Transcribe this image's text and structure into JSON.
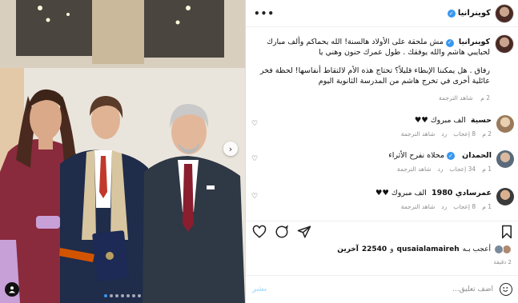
{
  "post": {
    "username": "كوينرانيا",
    "more_icon": "ellipsis-icon"
  },
  "caption": {
    "username": "كوينرانيا",
    "line1": "مش ملحقة على الأولاد هالسنة! الله يحماكم وألف مبارك لحبايبي هاشم والله يوفقك . طول عمرك حنون وهني يا",
    "line2": "رفاق . هل يمكننا الإبطاء قليلاً؟ تحتاج هذه الأم لالتقاط أنفاسها! لحظة فخر عائلية أخرى في تخرج هاشم من المدرسة الثانوية اليوم",
    "see_translation": "شاهد الترجمة",
    "age": "2 م"
  },
  "comments": [
    {
      "username": "حسية",
      "text": "الف مبروك ♥♥",
      "age": "2 م",
      "likes": "8 إعجاب",
      "reply": "رد",
      "see_translation": "شاهد الترجمة"
    },
    {
      "username": "الحمدان",
      "extra": "محلاه نفرح الأثراء",
      "age": "1 م",
      "likes": "34 إعجاب",
      "reply": "رد",
      "see_translation": "شاهد الترجمة"
    },
    {
      "username": "عمرسادي 1980",
      "text": "الف مبروك ♥♥",
      "age": "1 م",
      "likes": "8 إعجاب",
      "reply": "رد",
      "see_translation": "شاهد الترجمة"
    }
  ],
  "likes": {
    "prefix": "أعجب بـه",
    "user": "qusaialamaireh",
    "middle": "و",
    "count": "22540",
    "suffix": "آخرين"
  },
  "time_ago": "2 دقيقة",
  "add_comment": {
    "placeholder": "أضف تعليق...",
    "post_label": "نشر"
  },
  "colors": {
    "verified": "#3897f0",
    "muted": "#8e8e8e",
    "post_disabled": "#b2dffc"
  }
}
